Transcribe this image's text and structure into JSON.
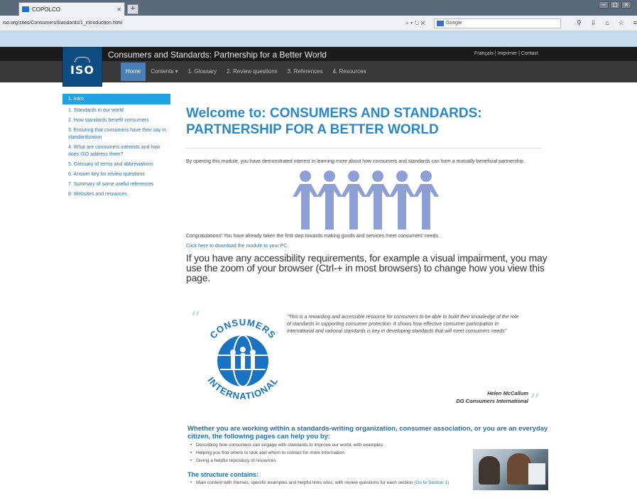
{
  "browser": {
    "tab_title": "COPOLCO",
    "new_tab": "+",
    "url": "iso.org/sites/ConsumersStandards/1_introduction.html",
    "url_controls": "⌕ ▾ ↻ ✕",
    "search_placeholder": "Google",
    "window_controls": [
      "–",
      "▢",
      "✕"
    ]
  },
  "site": {
    "logo": "ISO",
    "title": "Consumers and Standards: Partnership for a Better World",
    "top_links": "Français | Imprimer | Contact"
  },
  "nav": {
    "items": [
      "Home",
      "Contents ▾",
      "1. Glossary",
      "2. Review questions",
      "3. References",
      "4. Resources"
    ]
  },
  "sidebar": {
    "active": "1. Intro",
    "items": [
      "1. Standards in our world",
      "2. How standards benefit consumers",
      "3. Ensuring that consumers have their say in standardization",
      "4. What are consumers interests and how does ISO address them?",
      "5. Glossary of terms and abbreviations",
      "6. Answer key for review questions",
      "7. Summary of some useful references",
      "8. Websites and resources"
    ]
  },
  "main": {
    "title": "Welcome to: CONSUMERS AND STANDARDS: PARTNERSHIP FOR A BETTER WORLD",
    "intro": "By opening this module, you have demonstrated interest in learning more about how consumers and standards can form a mutually beneficial partnership.",
    "congrats": "Congratulations! You have already taken the first step towards making goods and services meet consumers' needs.",
    "download": "Click here to download the module to your PC.",
    "accessibility": "If you have any accessibility requirements, for example a visual impairment, you may use the zoom of your browser (Ctrl-+ in most browsers) to change how you view this page.",
    "quote": "\"This is a rewarding and accessible resource for consumers to be able to build their knowledge of the role of standards in supporting consumer protection. It shows how effective consumer participation in international and national standards is key in developing standards that will meet consumers needs\"",
    "author_name": "Helen McCallum",
    "author_org": "DG Consumers International",
    "ci_logo": {
      "top": "CONSUMERS",
      "bottom": "INTERNATIONAL"
    },
    "help_heading": "Whether you are working within a standards-writing organization, consumer association, or you are an everyday citizen, the following pages can help you by:",
    "help_items": [
      "Describing how consumers can engage with standards to improve our world, with examples",
      "Helping you find where to look and whom to contact for more information",
      "Giving a helpful repository of resources"
    ],
    "structure_heading": "The structure contains:",
    "structure_items": [
      {
        "text": "Main content with themes, specific examples and helpful links sites, with review questions for each section",
        "link": "(Go to Section 1)"
      }
    ]
  },
  "colors": {
    "accent": "#2a88c8",
    "nav_active": "#4a7fb5",
    "sidebar_active": "#1fa3e6",
    "figure": "#8e9fd6"
  }
}
